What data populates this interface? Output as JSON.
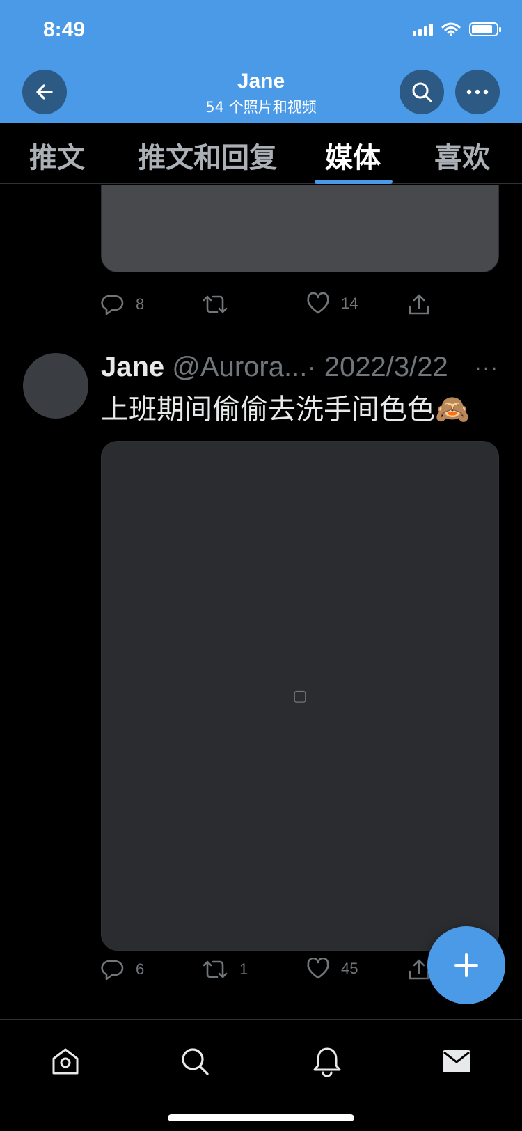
{
  "status_bar": {
    "time": "8:49",
    "battery_level": 0.85
  },
  "header": {
    "title": "Jane",
    "subtitle": "54 个照片和视频"
  },
  "tabs": [
    {
      "label": "推文"
    },
    {
      "label": "推文和回复"
    },
    {
      "label": "媒体",
      "active": true
    },
    {
      "label": "喜欢"
    }
  ],
  "previous_tweet": {
    "replies": "8",
    "retweets": "",
    "likes": "14"
  },
  "tweet": {
    "name": "Jane",
    "handle": "@Aurora...",
    "date": "· 2022/3/22",
    "text": "上班期间偷偷去洗手间色色🙈",
    "replies": "6",
    "retweets": "1",
    "likes": "45"
  },
  "colors": {
    "accent": "#4a9ae8",
    "header_bg": "#4a9ae8",
    "button_bg": "#2c5a85",
    "muted": "#71767b"
  },
  "icons": [
    "back-arrow-icon",
    "search-icon",
    "more-icon",
    "reply-icon",
    "retweet-icon",
    "like-icon",
    "share-icon",
    "compose-icon",
    "home-icon",
    "notifications-icon",
    "messages-icon"
  ]
}
